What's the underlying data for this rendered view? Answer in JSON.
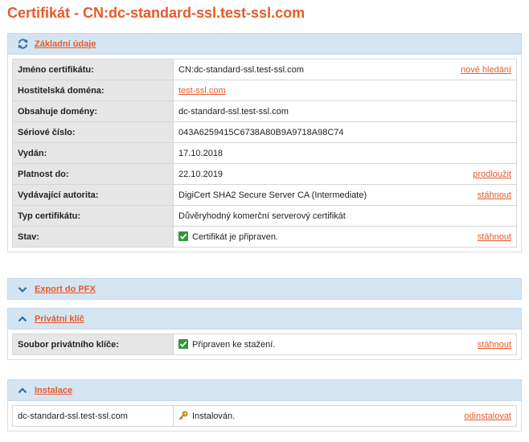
{
  "page_title": "Certifikát - CN:dc-standard-ssl.test-ssl.com",
  "basic": {
    "header": "Základní údaje",
    "rows": [
      {
        "label": "Jméno certifikátu:",
        "value": "CN:dc-standard-ssl.test-ssl.com",
        "action": "nové hledání"
      },
      {
        "label": "Hostitelská doména:",
        "link": "test-ssl.com"
      },
      {
        "label": "Obsahuje domény:",
        "value": "dc-standard-ssl.test-ssl.com"
      },
      {
        "label": "Sériové číslo:",
        "value": "043A6259415C6738A80B9A9718A98C74"
      },
      {
        "label": "Vydán:",
        "value": "17.10.2018"
      },
      {
        "label": "Platnost do:",
        "value": "22.10.2019",
        "action": "prodloužit"
      },
      {
        "label": "Vydávající autorita:",
        "value": "DigiCert SHA2 Secure Server CA (Intermediate)",
        "action": "stáhnout"
      },
      {
        "label": "Typ certifikátu:",
        "value": "Důvěryhodný komerční serverový certifikát"
      },
      {
        "label": "Stav:",
        "value": "Certifikát je připraven.",
        "action": "stáhnout"
      }
    ]
  },
  "export": {
    "header": "Export do PFX"
  },
  "private_key": {
    "header": "Privátní klíč",
    "row": {
      "label": "Soubor privátního klíče:",
      "value": "Připraven ke stažení.",
      "action": "stáhnout"
    }
  },
  "install": {
    "header": "Instalace",
    "row": {
      "label": "dc-standard-ssl.test-ssl.com",
      "value": "Instalován.",
      "action": "odinstalovat"
    }
  }
}
